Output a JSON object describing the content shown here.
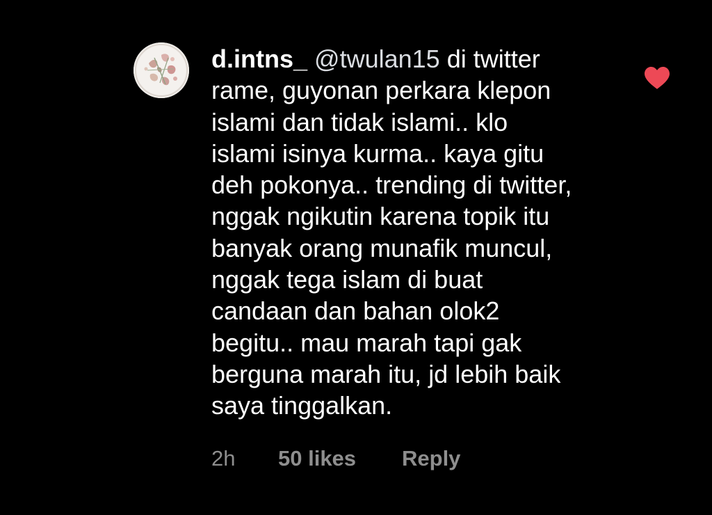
{
  "comment": {
    "username": "d.intns_",
    "mention": "@twulan15",
    "first_line_rest": "di twitter",
    "lines": [
      "rame, guyonan perkara klepon",
      "islami dan tidak islami.. klo",
      "islami isinya kurma.. kaya gitu",
      "deh pokonya.. trending di twitter,",
      "nggak ngikutin karena topik itu",
      "banyak orang munafik muncul,",
      "nggak tega islam di buat",
      "candaan dan bahan olok2",
      "begitu.. mau marah tapi gak",
      "berguna marah itu, jd lebih baik",
      "saya tinggalkan."
    ],
    "time": "2h",
    "likes": "50 likes",
    "reply_label": "Reply",
    "liked": true
  },
  "colors": {
    "background": "#000000",
    "text": "#ffffff",
    "mention": "#dadde2",
    "meta": "#8e8e8e",
    "heart": "#ed4956"
  },
  "icons": {
    "avatar": "avatar-dried-roses",
    "like": "heart-filled-icon"
  }
}
